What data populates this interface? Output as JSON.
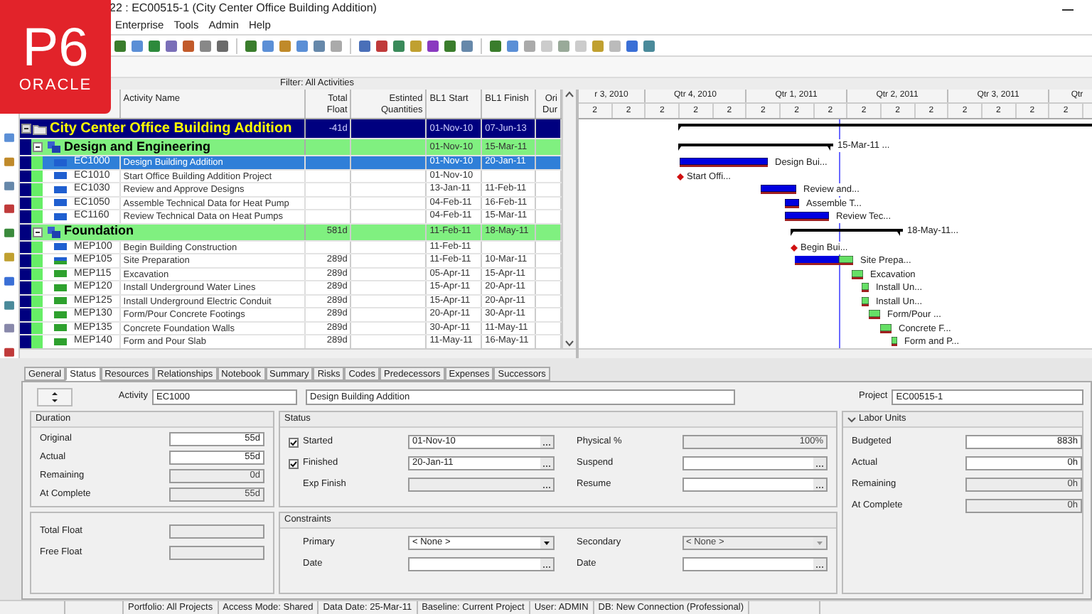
{
  "window": {
    "title": "22 : EC00515-1 (City Center Office Building Addition)"
  },
  "logo": {
    "mark": "P6",
    "wordmark": "ORACLE"
  },
  "menu": [
    {
      "label": "Enterprise"
    },
    {
      "label": "Tools"
    },
    {
      "label": "Admin"
    },
    {
      "label": "Help"
    }
  ],
  "filter_label": "Filter: All Activities",
  "columns": [
    {
      "label": "Activity Name"
    },
    {
      "label": "Total Float"
    },
    {
      "label": "Estinted Quantities"
    },
    {
      "label": "BL1 Start"
    },
    {
      "label": "BL1 Finish"
    },
    {
      "label": "Ori Dur"
    }
  ],
  "timescale": {
    "quarters": [
      "r 3, 2010",
      "Qtr 4, 2010",
      "Qtr 1, 2011",
      "Qtr 2, 2011",
      "Qtr 3, 2011",
      "Qtr"
    ],
    "units": [
      "2",
      "2",
      "2",
      "2",
      "2",
      "2",
      "2",
      "2",
      "2",
      "2",
      "2",
      "2",
      "2",
      "2",
      "2"
    ]
  },
  "rows": [
    {
      "kind": "project",
      "name": "City Center Office Building Addition",
      "total_float": "-41d",
      "bl1_start": "01-Nov-10",
      "bl1_finish": "07-Jun-13",
      "expanded": true,
      "selected": false,
      "children": [
        {
          "kind": "wbs",
          "name": "Design and Engineering",
          "bl1_start": "01-Nov-10",
          "bl1_finish": "15-Mar-11",
          "expanded": true,
          "selected": false,
          "bar_label": "15-Mar-11 ...",
          "children": [
            {
              "kind": "task",
              "id": "EC1000",
              "name": "Design Building Addition",
              "started": true,
              "completed": true,
              "bl1_start": "01-Nov-10",
              "bl1_finish": "20-Jan-11",
              "selected": true,
              "bar_label": "Design Bui..."
            },
            {
              "kind": "milestone",
              "id": "EC1010",
              "name": "Start Office Building Addition Project",
              "started": true,
              "completed": true,
              "bl1_start": "01-Nov-10",
              "selected": false,
              "bar_label": "Start Offi..."
            },
            {
              "kind": "task",
              "id": "EC1030",
              "name": "Review and Approve Designs",
              "started": true,
              "completed": true,
              "bl1_start": "13-Jan-11",
              "bl1_finish": "11-Feb-11",
              "selected": false,
              "bar_label": "Review and..."
            },
            {
              "kind": "task",
              "id": "EC1050",
              "name": "Assemble Technical Data for Heat Pump",
              "started": true,
              "completed": true,
              "bl1_start": "04-Feb-11",
              "bl1_finish": "16-Feb-11",
              "selected": false,
              "bar_label": "Assemble T..."
            },
            {
              "kind": "task",
              "id": "EC1160",
              "name": "Review Technical Data on Heat Pumps",
              "started": true,
              "completed": true,
              "bl1_start": "04-Feb-11",
              "bl1_finish": "15-Mar-11",
              "selected": false,
              "bar_label": "Review Tec..."
            }
          ]
        },
        {
          "kind": "wbs",
          "name": "Foundation",
          "total_float": "581d",
          "bl1_start": "11-Feb-11",
          "bl1_finish": "18-May-11",
          "expanded": true,
          "selected": false,
          "bar_label": "18-May-11...",
          "children": [
            {
              "kind": "milestone",
              "id": "MEP100",
              "name": "Begin Building Construction",
              "started": true,
              "completed": true,
              "bl1_start": "11-Feb-11",
              "selected": false,
              "bar_label": "Begin Bui..."
            },
            {
              "kind": "task",
              "id": "MEP105",
              "name": "Site Preparation",
              "started": true,
              "completed": false,
              "total_float": "289d",
              "bl1_start": "11-Feb-11",
              "bl1_finish": "10-Mar-11",
              "selected": false,
              "bar_label": "Site Prepa..."
            },
            {
              "kind": "task",
              "id": "MEP115",
              "name": "Excavation",
              "started": false,
              "completed": false,
              "total_float": "289d",
              "bl1_start": "05-Apr-11",
              "bl1_finish": "15-Apr-11",
              "selected": false,
              "bar_label": "Excavation"
            },
            {
              "kind": "task",
              "id": "MEP120",
              "name": "Install Underground Water Lines",
              "started": false,
              "completed": false,
              "total_float": "289d",
              "bl1_start": "15-Apr-11",
              "bl1_finish": "20-Apr-11",
              "selected": false,
              "bar_label": "Install Un..."
            },
            {
              "kind": "task",
              "id": "MEP125",
              "name": "Install Underground Electric Conduit",
              "started": false,
              "completed": false,
              "total_float": "289d",
              "bl1_start": "15-Apr-11",
              "bl1_finish": "20-Apr-11",
              "selected": false,
              "bar_label": "Install Un..."
            },
            {
              "kind": "task",
              "id": "MEP130",
              "name": "Form/Pour Concrete Footings",
              "started": false,
              "completed": false,
              "total_float": "289d",
              "bl1_start": "20-Apr-11",
              "bl1_finish": "30-Apr-11",
              "selected": false,
              "bar_label": "Form/Pour ..."
            },
            {
              "kind": "task",
              "id": "MEP135",
              "name": "Concrete Foundation Walls",
              "started": false,
              "completed": false,
              "total_float": "289d",
              "bl1_start": "30-Apr-11",
              "bl1_finish": "11-May-11",
              "selected": false,
              "bar_label": "Concrete F..."
            },
            {
              "kind": "task",
              "id": "MEP140",
              "name": "Form and Pour Slab",
              "started": false,
              "completed": false,
              "total_float": "289d",
              "bl1_start": "11-May-11",
              "bl1_finish": "16-May-11",
              "selected": false,
              "bar_label": "Form and P..."
            }
          ]
        }
      ]
    }
  ],
  "detail": {
    "tabs": [
      {
        "label": "General",
        "selected": false
      },
      {
        "label": "Status",
        "selected": true
      },
      {
        "label": "Resources",
        "selected": false
      },
      {
        "label": "Relationships",
        "selected": false
      },
      {
        "label": "Notebook",
        "selected": false
      },
      {
        "label": "Summary",
        "selected": false
      },
      {
        "label": "Risks",
        "selected": false
      },
      {
        "label": "Codes",
        "selected": false
      },
      {
        "label": "Predecessors",
        "selected": false
      },
      {
        "label": "Expenses",
        "selected": false
      },
      {
        "label": "Successors",
        "selected": false
      }
    ],
    "activity_label": "Activity",
    "activity_id": "EC1000",
    "activity_name": "Design Building Addition",
    "project_label": "Project",
    "project_id": "EC00515-1",
    "duration": {
      "title": "Duration",
      "fields": [
        {
          "label": "Original",
          "value": "55d",
          "disabled": false
        },
        {
          "label": "Actual",
          "value": "55d",
          "disabled": false
        },
        {
          "label": "Remaining",
          "value": "0d",
          "disabled": true
        },
        {
          "label": "At Complete",
          "value": "55d",
          "disabled": true
        }
      ]
    },
    "float": {
      "fields": [
        {
          "label": "Total Float",
          "disabled": true
        },
        {
          "label": "Free Float",
          "disabled": true
        }
      ]
    },
    "status": {
      "title": "Status",
      "fields": [
        {
          "kind": "date",
          "label": "Started",
          "checked": true,
          "value": "01-Nov-10",
          "disabled": false
        },
        {
          "kind": "number",
          "label": "Physical %",
          "value": "100%",
          "disabled": true
        },
        {
          "kind": "date",
          "label": "Finished",
          "checked": true,
          "value": "20-Jan-11",
          "disabled": false
        },
        {
          "kind": "date",
          "label": "Suspend",
          "disabled": false
        },
        {
          "kind": "date",
          "label": "Exp Finish",
          "disabled": true
        },
        {
          "kind": "date",
          "label": "Resume",
          "disabled": false
        }
      ]
    },
    "constraints": {
      "title": "Constraints",
      "fields": [
        {
          "kind": "dropdown",
          "label": "Primary",
          "value": "< None >",
          "disabled": false
        },
        {
          "kind": "dropdown",
          "label": "Secondary",
          "value": "< None >",
          "disabled": true
        },
        {
          "kind": "date",
          "label": "Date",
          "disabled": false
        },
        {
          "kind": "date",
          "label": "Date",
          "disabled": false
        }
      ]
    },
    "labor": {
      "title": "Labor Units",
      "expanded": true,
      "fields": [
        {
          "label": "Budgeted",
          "value": "883h",
          "disabled": false
        },
        {
          "label": "Actual",
          "value": "0h",
          "disabled": false
        },
        {
          "label": "Remaining",
          "value": "0h",
          "disabled": true
        },
        {
          "label": "At Complete",
          "value": "0h",
          "disabled": true
        }
      ]
    }
  },
  "status_bar": [
    {
      "text": "Portfolio: All Projects"
    },
    {
      "text": "Access Mode: Shared"
    },
    {
      "text": "Data Date: 25-Mar-11"
    },
    {
      "text": "Baseline: Current Project"
    },
    {
      "text": "User: ADMIN"
    },
    {
      "text": "DB: New Connection (Professional)"
    }
  ]
}
